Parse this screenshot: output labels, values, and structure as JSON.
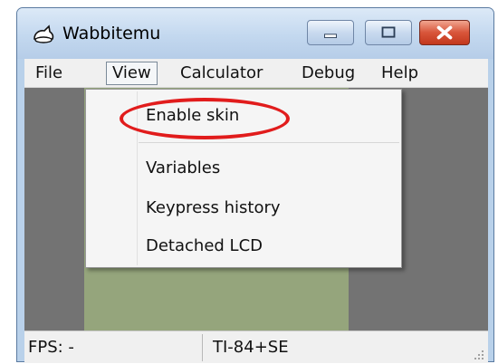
{
  "window": {
    "title": "Wabbitemu",
    "app_icon": "rabbit-icon"
  },
  "title_controls": {
    "minimize_icon": "minimize-icon",
    "maximize_icon": "maximize-icon",
    "close_icon": "close-icon",
    "close_color": "#d8553a"
  },
  "menubar": {
    "items": [
      "File",
      "View",
      "Calculator",
      "Debug",
      "Help"
    ],
    "active": "View"
  },
  "view_menu": {
    "items": [
      "Enable skin",
      "Variables",
      "Keypress history",
      "Detached LCD"
    ]
  },
  "statusbar": {
    "fps": "FPS: -",
    "model": "TI-84+SE"
  },
  "colors": {
    "lcd": "#95a57c",
    "highlight": "#e11c1c"
  }
}
